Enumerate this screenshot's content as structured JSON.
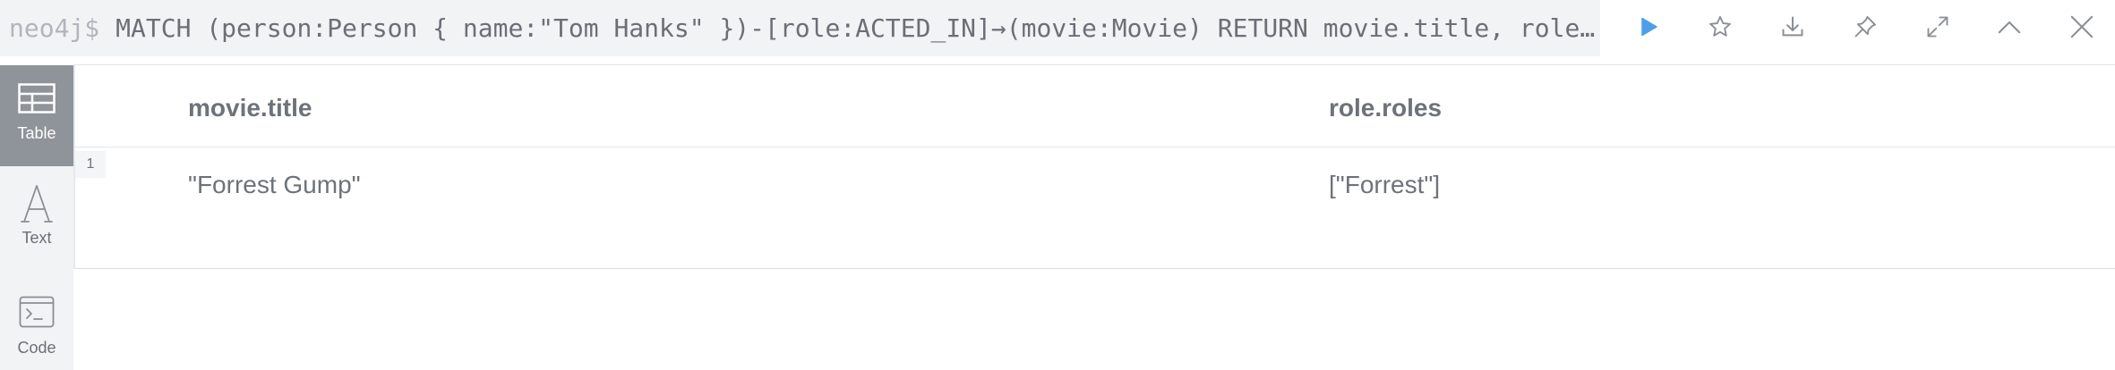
{
  "query": {
    "prompt": "neo4j$",
    "text": "MATCH (person:Person { name:\"Tom Hanks\" })-[role:ACTED_IN]→(movie:Movie) RETURN movie.title, role.roles"
  },
  "toolbar": {
    "run_icon": "play-icon",
    "favorite_icon": "star-icon",
    "export_icon": "download-icon",
    "pin_icon": "pin-icon",
    "fullscreen_icon": "expand-icon",
    "collapse_icon": "chevron-up-icon",
    "close_icon": "close-icon",
    "accent_color": "#4c9ee8"
  },
  "sidebar": {
    "items": [
      {
        "label": "Table",
        "icon": "table-icon",
        "active": true
      },
      {
        "label": "Text",
        "icon": "text-icon",
        "active": false
      },
      {
        "label": "Code",
        "icon": "code-icon",
        "active": false
      }
    ]
  },
  "table": {
    "columns": [
      "movie.title",
      "role.roles"
    ],
    "rows": [
      {
        "index": "1",
        "cells": [
          "\"Forrest Gump\"",
          "[\"Forrest\"]"
        ]
      }
    ]
  }
}
